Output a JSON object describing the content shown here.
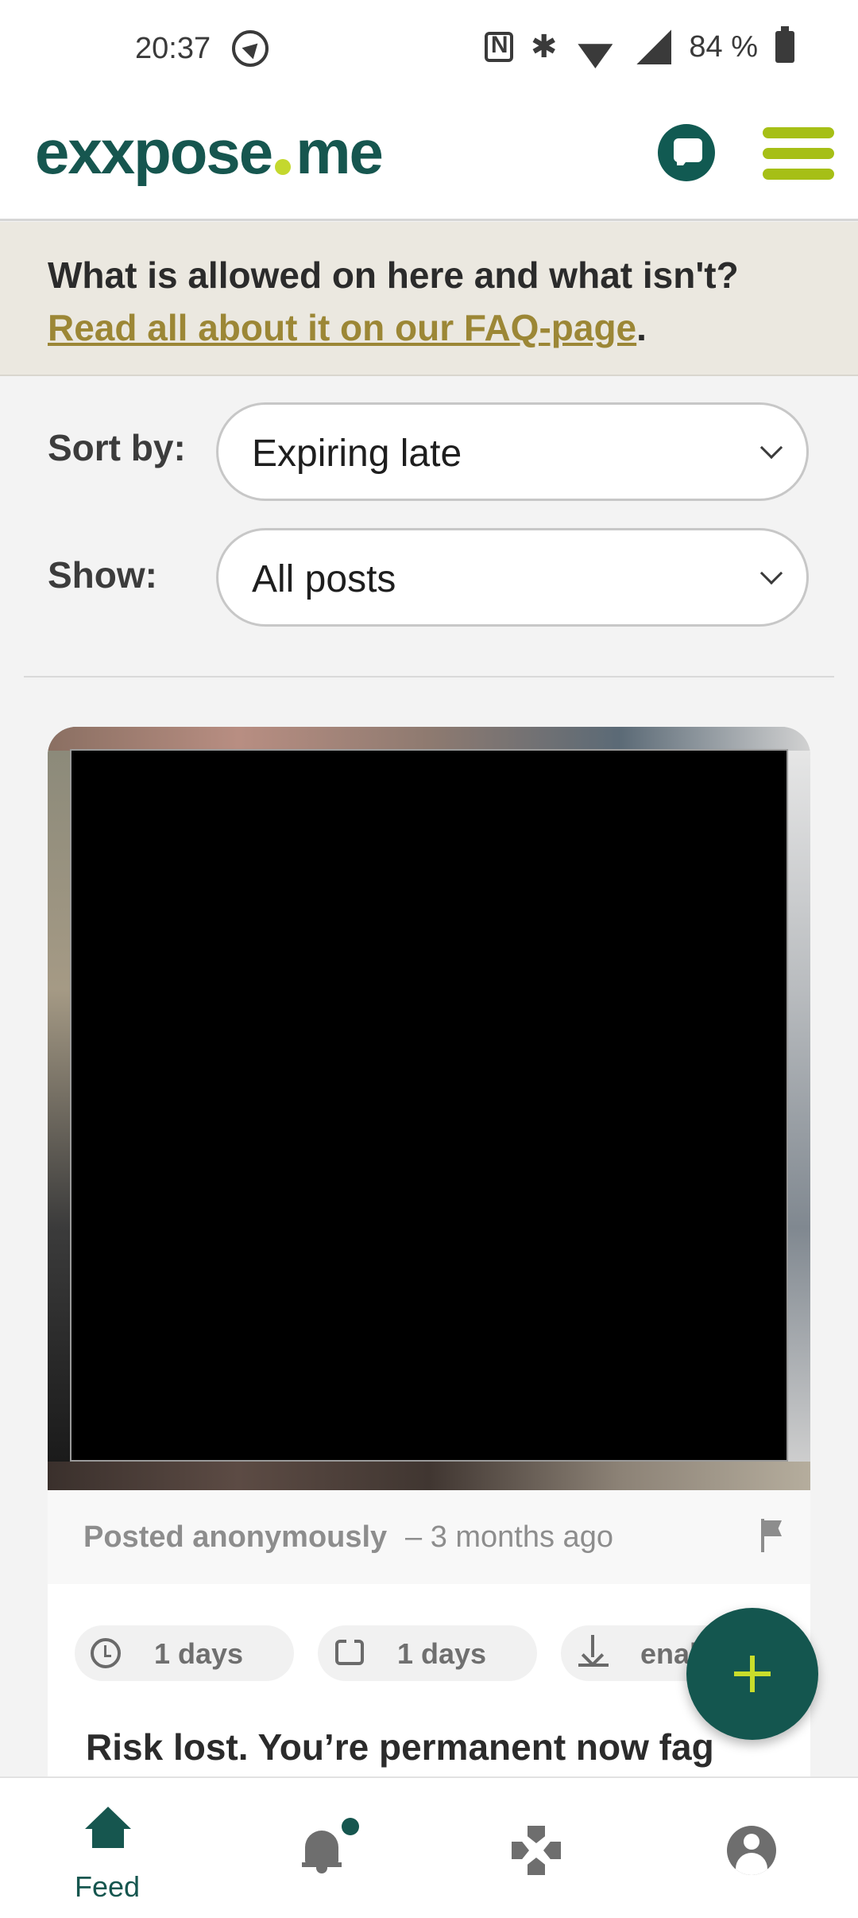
{
  "status_bar": {
    "time": "20:37",
    "battery": "84 %",
    "icons": [
      "nav-arrow-icon",
      "nfc-icon",
      "bluetooth-icon",
      "wifi-icon",
      "signal-icon",
      "battery-icon"
    ]
  },
  "header": {
    "logo_part1": "exxpose",
    "logo_part2": "me",
    "icons": [
      "chat-icon",
      "hamburger-menu-icon"
    ]
  },
  "notice": {
    "text": "What is allowed on here and what isn't?",
    "link": "Read all about it on our FAQ-page",
    "period": "."
  },
  "filters": {
    "sort_label": "Sort by:",
    "sort_value": "Expiring late",
    "show_label": "Show:",
    "show_value": "All posts"
  },
  "post": {
    "author": "Posted anonymously",
    "time": "– 3 months ago",
    "chips": [
      {
        "icon": "clock-icon",
        "label": "1 days"
      },
      {
        "icon": "repeat-icon",
        "label": "1 days"
      },
      {
        "icon": "download-icon",
        "label": "enab"
      }
    ],
    "title": "Risk lost. You’re permanent now fag"
  },
  "bottom_nav": {
    "items": [
      {
        "icon": "home-icon",
        "label": "Feed",
        "active": true
      },
      {
        "icon": "bell-icon",
        "label": ""
      },
      {
        "icon": "gamepad-icon",
        "label": ""
      },
      {
        "icon": "account-icon",
        "label": ""
      }
    ]
  },
  "colors": {
    "brand_green": "#16564f",
    "accent_lime": "#c4d82e",
    "link_gold": "#9c8736",
    "notice_bg": "#ebe8e0"
  }
}
